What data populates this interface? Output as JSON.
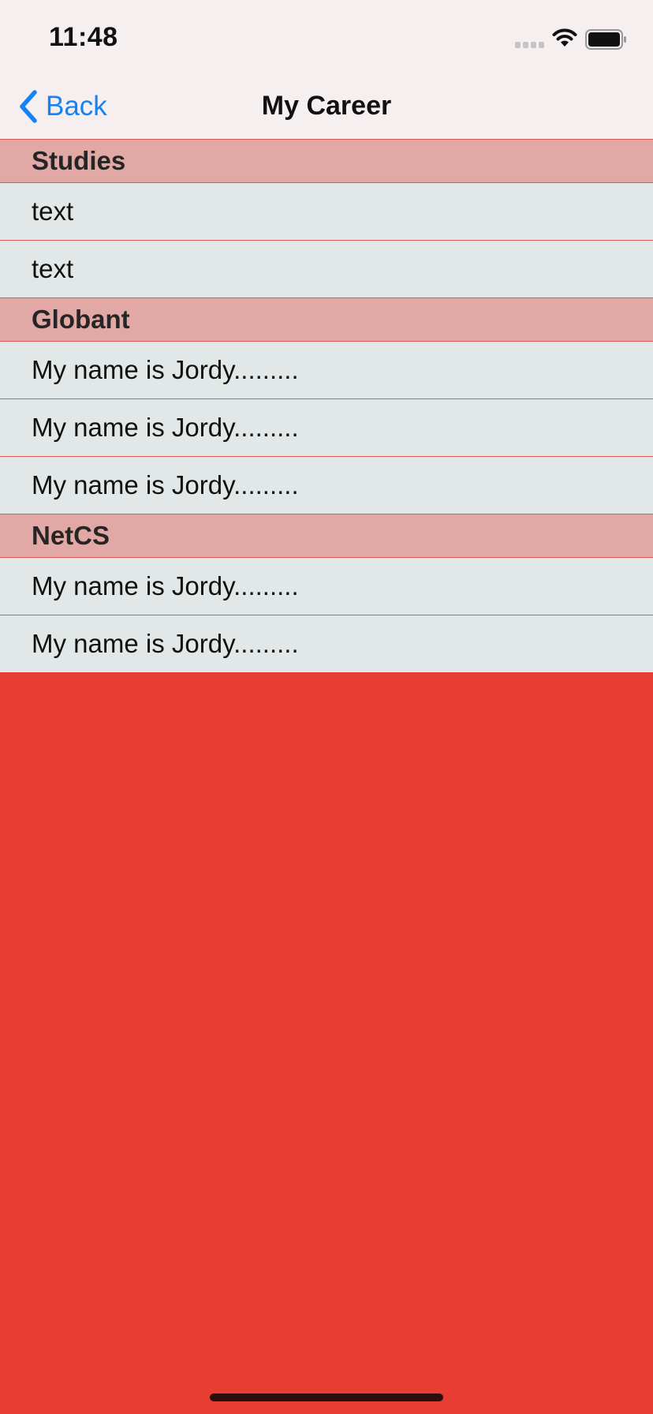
{
  "status_bar": {
    "time": "11:48"
  },
  "nav": {
    "back_label": "Back",
    "title": "My Career"
  },
  "sections": [
    {
      "header": "Studies",
      "rows": [
        "text",
        "text"
      ]
    },
    {
      "header": "Globant",
      "rows": [
        "My name is Jordy.........",
        "My name is Jordy.........",
        "My name is Jordy........."
      ]
    },
    {
      "header": "NetCS",
      "rows": [
        "My name is Jordy.........",
        "My name is Jordy........."
      ]
    }
  ],
  "colors": {
    "background": "#e83d32",
    "nav_background": "#f5eff0",
    "section_header": "#e1a8a5",
    "row_background": "#e2e8e7",
    "separator": "#d65b54",
    "accent": "#1682f6"
  },
  "icons": {
    "back": "chevron-left-icon",
    "signal": "signal-dots-icon",
    "wifi": "wifi-icon",
    "battery": "battery-icon"
  }
}
